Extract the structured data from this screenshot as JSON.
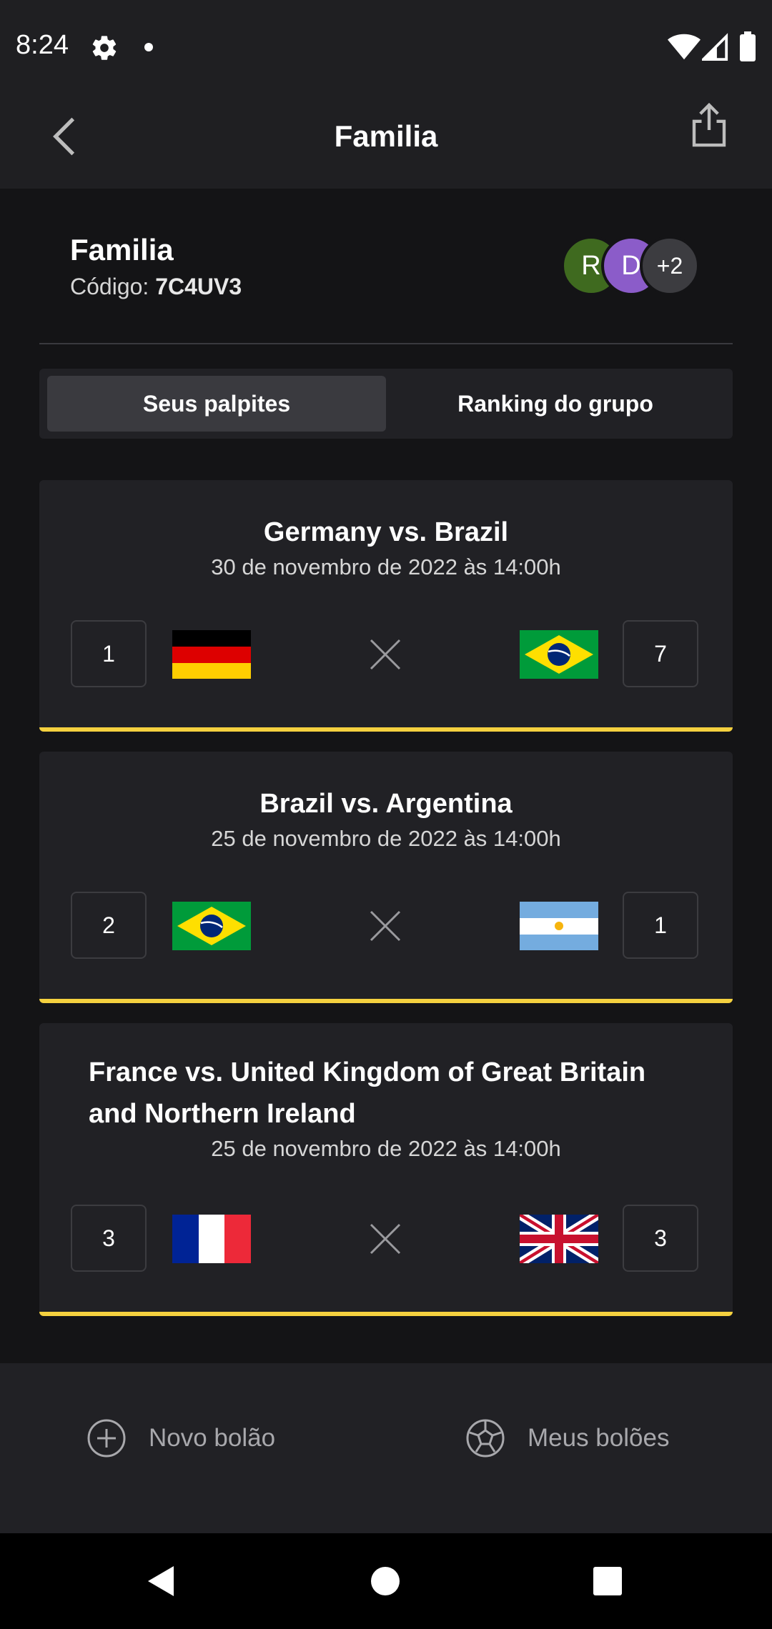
{
  "status_bar": {
    "time": "8:24"
  },
  "app_bar": {
    "title": "Familia"
  },
  "group": {
    "name": "Familia",
    "code_label": "Código:",
    "code_value": "7C4UV3",
    "avatars": [
      {
        "letter": "R",
        "color": "#3f6a1f"
      },
      {
        "letter": "D",
        "color": "#8b5cc9"
      },
      {
        "letter": "+2",
        "color": "#3c3c40"
      }
    ]
  },
  "tabs": [
    {
      "label": "Seus palpites",
      "active": true
    },
    {
      "label": "Ranking do grupo",
      "active": false
    }
  ],
  "matches": [
    {
      "title": "Germany vs. Brazil",
      "date": "30 de novembro de 2022 às 14:00h",
      "home_score": "1",
      "away_score": "7",
      "home_flag": "germany-flag-icon",
      "away_flag": "brazil-flag-icon"
    },
    {
      "title": "Brazil vs. Argentina",
      "date": "25 de novembro de 2022 às 14:00h",
      "home_score": "2",
      "away_score": "1",
      "home_flag": "brazil-flag-icon",
      "away_flag": "argentina-flag-icon"
    },
    {
      "title": "France vs. United Kingdom of Great Britain and Northern Ireland",
      "date": "25 de novembro de 2022 às 14:00h",
      "home_score": "3",
      "away_score": "3",
      "home_flag": "france-flag-icon",
      "away_flag": "uk-flag-icon"
    }
  ],
  "bottom_nav": {
    "new_pool": "Novo bolão",
    "my_pools": "Meus bolões"
  },
  "colors": {
    "accent": "#f5d13f",
    "background": "#141416",
    "card": "#212125"
  }
}
